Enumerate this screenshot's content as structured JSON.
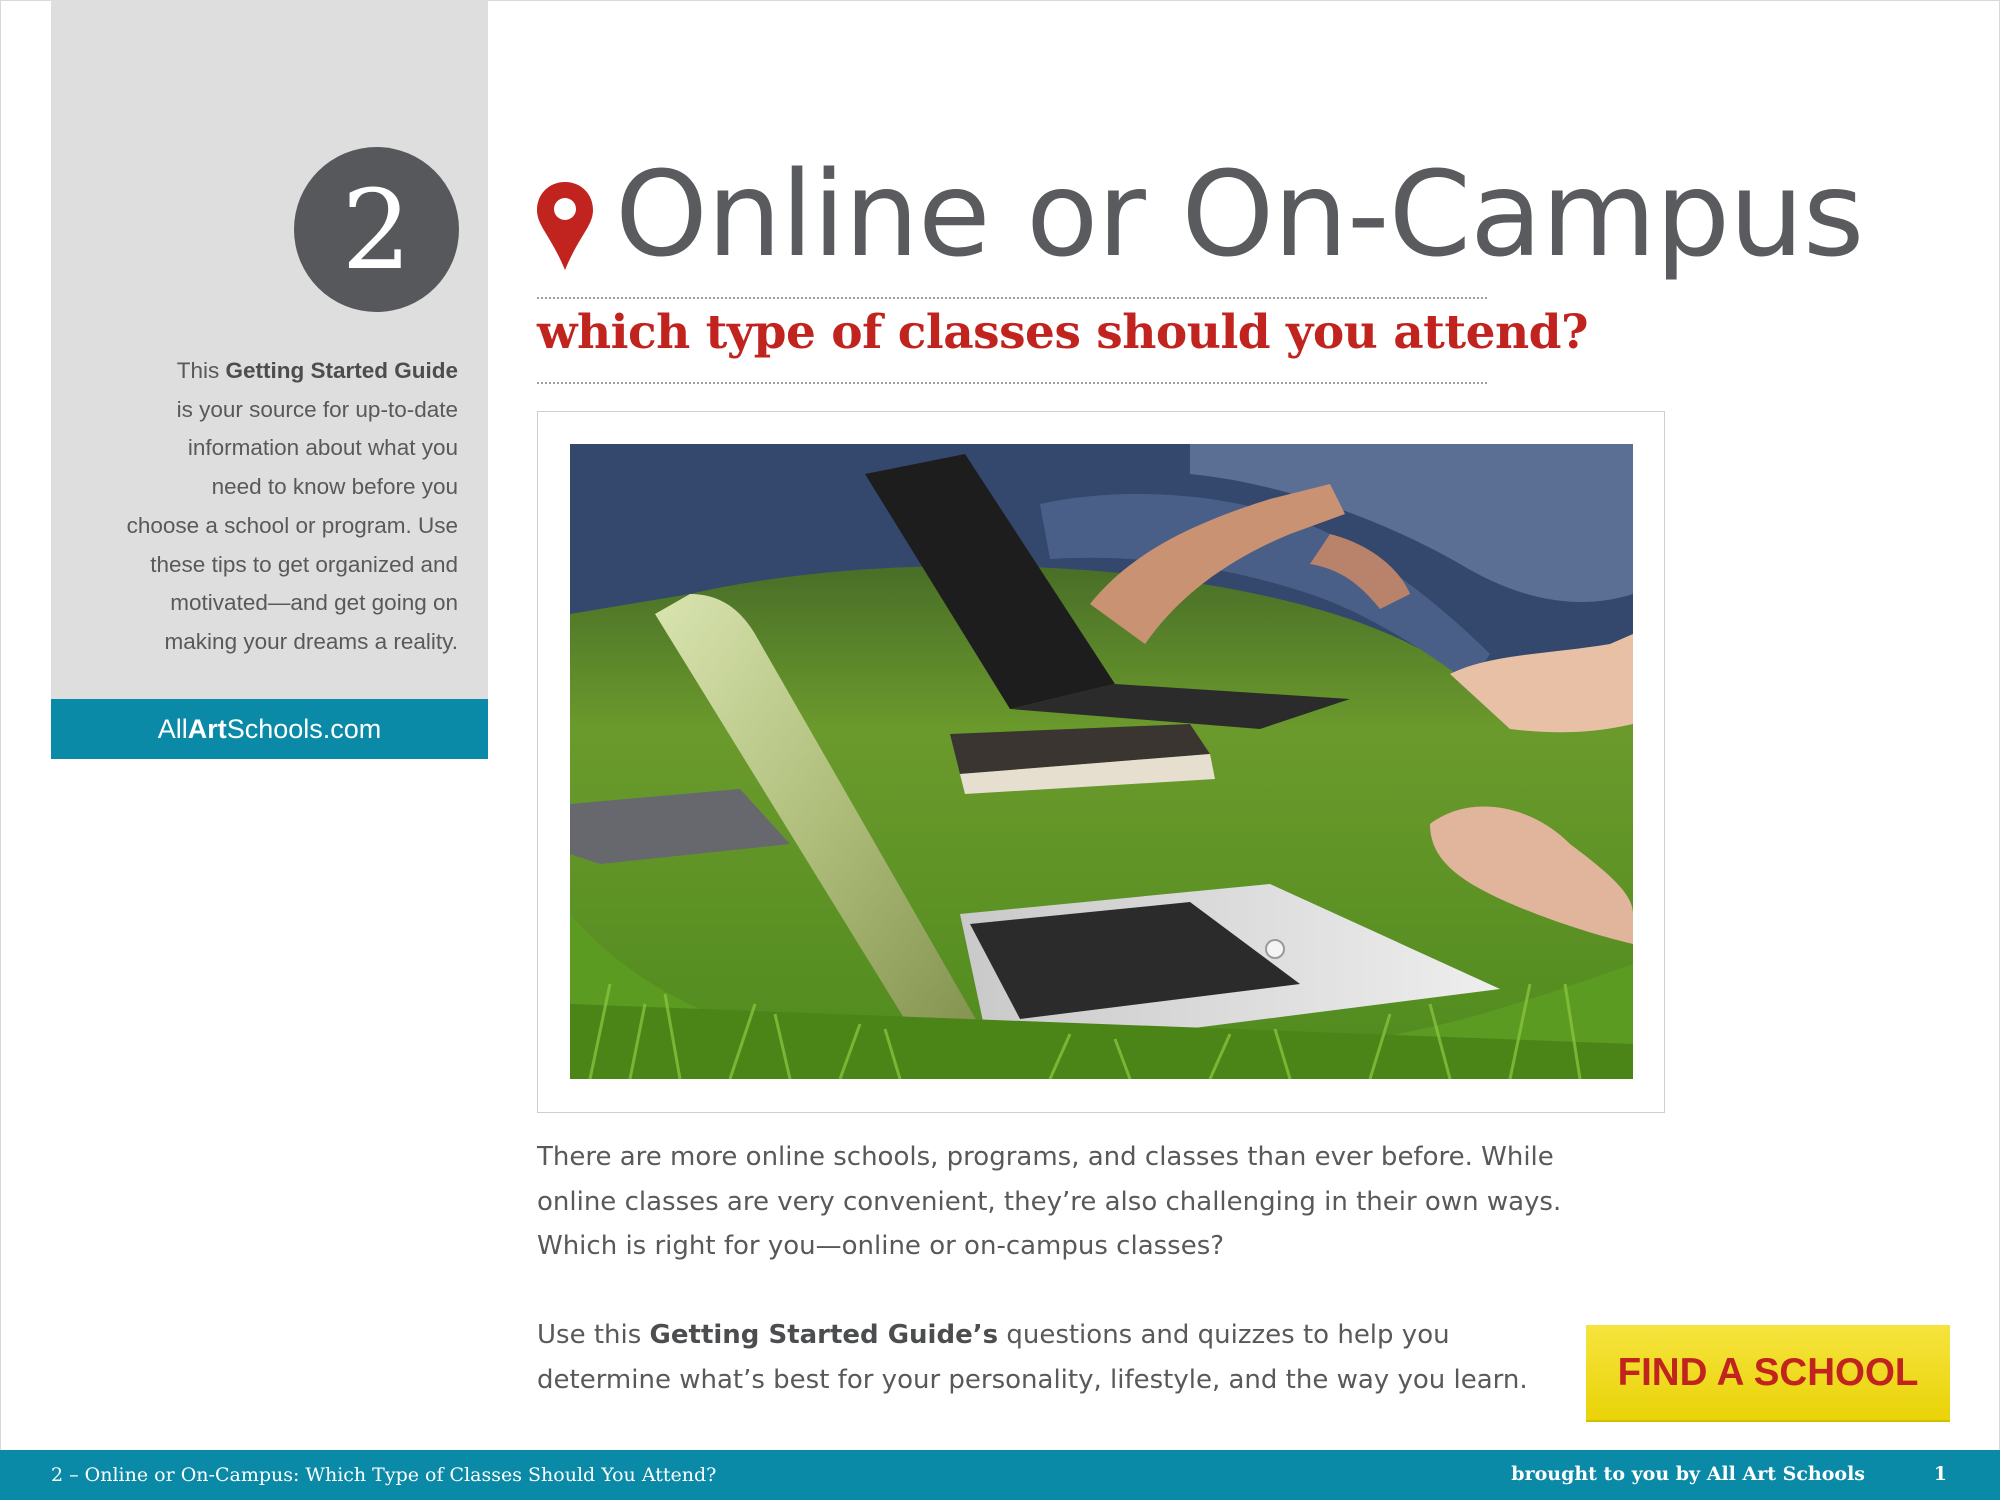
{
  "sidebar": {
    "chapter_number": "2",
    "intro_pre": "This ",
    "intro_bold": "Getting Started Guide",
    "intro_rest_lines": [
      "is your source for up-to-date",
      "information about what you",
      "need to know before you",
      "choose a school or program. Use",
      "these tips to get organized and",
      "motivated—and get going on",
      "making your dreams a reality."
    ],
    "site_prefix": "All",
    "site_bold": "Art",
    "site_suffix": "Schools.com"
  },
  "header": {
    "title": "Online or On-Campus",
    "subtitle": "which type of classes should you attend?"
  },
  "photo": {
    "icon": "photo-students-laptops-on-grass"
  },
  "body": {
    "paragraph1_lines": [
      "There are more online schools, programs, and classes than ever before. While",
      "online classes are very convenient, they’re also challenging in their own ways.",
      "Which is right for you—online or on-campus classes?"
    ],
    "p2_pre": "Use this ",
    "p2_bold": "Getting Started Guide’s",
    "p2_line1_rest": " questions and quizzes to help you",
    "p2_line2": "determine what’s best for your personality, lifestyle, and the way you learn."
  },
  "cta": {
    "label": "FIND A SCHOOL"
  },
  "footer": {
    "left_text": "2 – Online or On-Campus: Which Type of Classes Should You Attend?",
    "right_text": "brought to you by All Art Schools",
    "page_number": "1"
  },
  "colors": {
    "accent_red": "#c1231f",
    "teal": "#0a8aa7",
    "sidebar_gray": "#dedede",
    "text_gray": "#58595b",
    "button_yellow": "#f6e43e"
  }
}
